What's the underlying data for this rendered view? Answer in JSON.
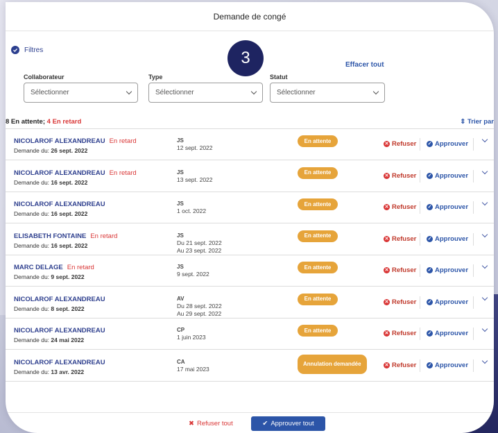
{
  "title": "Demande de congé",
  "step_badge": "3",
  "filters": {
    "label": "Filtres",
    "clear_all": "Effacer tout",
    "collaborateur": {
      "label": "Collaborateur",
      "placeholder": "Sélectionner"
    },
    "type": {
      "label": "Type",
      "placeholder": "Sélectionner"
    },
    "statut": {
      "label": "Statut",
      "placeholder": "Sélectionner"
    }
  },
  "summary": {
    "pending": "8 En attente;",
    "late": "4 En retard"
  },
  "sort_label": "Trier par",
  "actions": {
    "refuse": "Refuser",
    "approve": "Approuver"
  },
  "requests": [
    {
      "name": "NICOLAROF ALEXANDREAU",
      "late": "En retard",
      "date_prefix": "Demande du:",
      "date": "26 sept. 2022",
      "type": "JS",
      "line1": "12 sept. 2022",
      "line2": "",
      "status": "En attente"
    },
    {
      "name": "NICOLAROF ALEXANDREAU",
      "late": "En retard",
      "date_prefix": "Demande du:",
      "date": "16 sept. 2022",
      "type": "JS",
      "line1": "13 sept. 2022",
      "line2": "",
      "status": "En attente"
    },
    {
      "name": "NICOLAROF ALEXANDREAU",
      "late": "",
      "date_prefix": "Demande du:",
      "date": "16 sept. 2022",
      "type": "JS",
      "line1": "1 oct. 2022",
      "line2": "",
      "status": "En attente"
    },
    {
      "name": "ELISABETH FONTAINE",
      "late": "En retard",
      "date_prefix": "Demande du:",
      "date": "16 sept. 2022",
      "type": "JS",
      "line1": "Du 21 sept. 2022",
      "line2": "Au 23 sept. 2022",
      "status": "En attente"
    },
    {
      "name": "MARC DELAGE",
      "late": "En retard",
      "date_prefix": "Demande du:",
      "date": "9 sept. 2022",
      "type": "JS",
      "line1": "9 sept. 2022",
      "line2": "",
      "status": "En attente"
    },
    {
      "name": "NICOLAROF ALEXANDREAU",
      "late": "",
      "date_prefix": "Demande du:",
      "date": "8 sept. 2022",
      "type": "AV",
      "line1": "Du 28 sept. 2022",
      "line2": "Au 29 sept. 2022",
      "status": "En attente"
    },
    {
      "name": "NICOLAROF ALEXANDREAU",
      "late": "",
      "date_prefix": "Demande du:",
      "date": "24 mai 2022",
      "type": "CP",
      "line1": "1 juin 2023",
      "line2": "",
      "status": "En attente"
    },
    {
      "name": "NICOLAROF ALEXANDREAU",
      "late": "",
      "date_prefix": "Demande du:",
      "date": "13 avr. 2022",
      "type": "CA",
      "line1": "17 mai 2023",
      "line2": "",
      "status": "Annulation demandée"
    }
  ],
  "footer": {
    "refuse_all": "Refuser tout",
    "approve_all": "Approuver tout"
  },
  "colors": {
    "primary": "#2c55a8",
    "navy": "#1e2461",
    "late": "#d93535",
    "status": "#e6a43a"
  }
}
